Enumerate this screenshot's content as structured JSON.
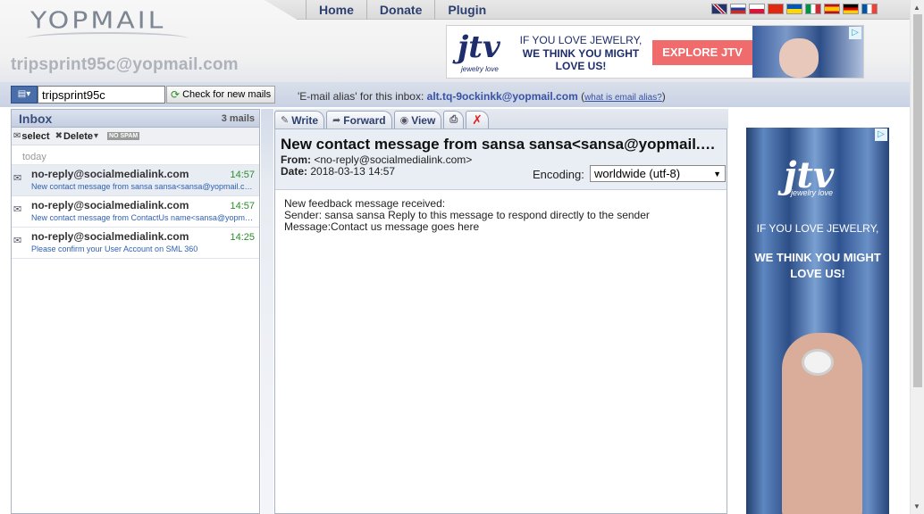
{
  "logo": {
    "text": "YOPMAIL"
  },
  "mailbox_email": "tripsprint95c@yopmail.com",
  "top_nav": {
    "items": [
      "Home",
      "Donate",
      "Plugin"
    ]
  },
  "flags": [
    "en",
    "ru",
    "pl",
    "cn",
    "ua",
    "it",
    "es",
    "de",
    "fr"
  ],
  "top_ad": {
    "brand": "jtv",
    "brand_sub": "jewelry love",
    "line1": "IF YOU LOVE JEWELRY,",
    "line2": "WE THINK YOU MIGHT LOVE US!",
    "cta": "EXPLORE JTV"
  },
  "login": {
    "value": "tripsprint95c",
    "check_button": "Check for new mails"
  },
  "alias": {
    "prefix": "'E-mail alias' for this inbox:",
    "address": "alt.tq-9ockinkk@yopmail.com",
    "help_link": "what is email alias?"
  },
  "inbox": {
    "title": "Inbox",
    "count": "3 mails",
    "toolbar": {
      "select": "select",
      "delete": "Delete",
      "nospam": "NO SPAM"
    },
    "group": "today",
    "mails": [
      {
        "from": "no-reply@socialmedialink.com",
        "time": "14:57",
        "subject": "New contact message from sansa sansa<sansa@yopmail.com>"
      },
      {
        "from": "no-reply@socialmedialink.com",
        "time": "14:57",
        "subject": "New contact message from ContactUs name<sansa@yopmail.com>"
      },
      {
        "from": "no-reply@socialmedialink.com",
        "time": "14:25",
        "subject": "Please confirm your User Account on SML 360"
      }
    ]
  },
  "message_toolbar": {
    "write": "Write",
    "forward": "Forward",
    "view": "View"
  },
  "message": {
    "subject": "New contact message from sansa sansa<sansa@yopmail.com>",
    "from_label": "From:",
    "from": "<no-reply@socialmedialink.com>",
    "date_label": "Date:",
    "date": "2018-03-13 14:57",
    "encoding_label": "Encoding:",
    "encoding_value": "worldwide (utf-8)",
    "body_lines": [
      "New feedback message received:",
      "Sender: sansa sansa Reply to this message to respond directly to the sender",
      "Message:Contact us message goes here"
    ]
  },
  "side_ad": {
    "brand": "jtv",
    "brand_sub": "jewelry love",
    "line1": "IF YOU LOVE JEWELRY,",
    "line2": "WE THINK YOU MIGHT LOVE US!"
  },
  "colors": {
    "accent": "#3952a3",
    "time_green": "#2b8c2b",
    "cta": "#f06b6b"
  }
}
